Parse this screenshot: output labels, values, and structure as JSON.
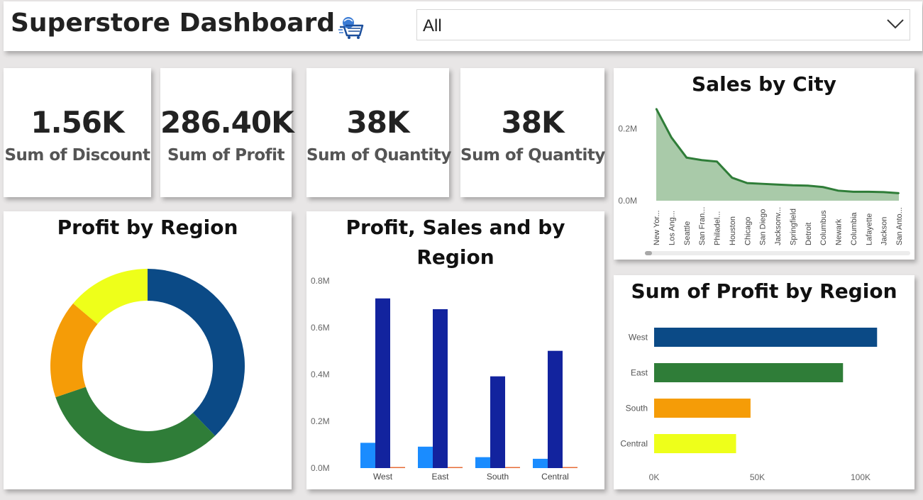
{
  "header": {
    "title": "Superstore Dashboard",
    "logo_icon": "shopping-cart-icon",
    "filter_value": "All",
    "filter_icon": "chevron-down-icon"
  },
  "kpis": [
    {
      "value": "1.56K",
      "label": "Sum of Discount"
    },
    {
      "value": "286.40K",
      "label": "Sum of Profit"
    },
    {
      "value": "38K",
      "label": "Sum of Quantity"
    },
    {
      "value": "38K",
      "label": "Sum of Quantity"
    }
  ],
  "colors": {
    "west": "#0b4a86",
    "east": "#2f7d38",
    "south": "#f59c07",
    "central": "#eeff1a",
    "profit": "#1a8cff",
    "sales": "#12239e",
    "third": "#e66c37",
    "area_line": "#2f7d38",
    "area_fill": "#a9caa9"
  },
  "chart_data": [
    {
      "id": "sales_by_city",
      "type": "area",
      "title": "Sales by City",
      "categories": [
        "New Yor...",
        "Los Ang...",
        "Seattle",
        "San Fran...",
        "Philadel...",
        "Houston",
        "Chicago",
        "San Diego",
        "Jacksonv...",
        "Springfield",
        "Detroit",
        "Columbus",
        "Newark",
        "Columbia",
        "Lafayette",
        "Jackson",
        "San Anto..."
      ],
      "values": [
        256000,
        176000,
        120000,
        113000,
        109000,
        64000,
        49000,
        47000,
        45000,
        43000,
        42000,
        38000,
        28000,
        25000,
        25000,
        24000,
        21000
      ],
      "yticks": [
        "0.0M",
        "0.2M"
      ],
      "ylim": [
        0,
        300000
      ],
      "grid": false
    },
    {
      "id": "profit_by_region_donut",
      "type": "pie",
      "title": "Profit by Region",
      "categories": [
        "West",
        "East",
        "South",
        "Central"
      ],
      "values": [
        108000,
        91500,
        46700,
        39700
      ]
    },
    {
      "id": "profit_sales_by_region",
      "type": "bar",
      "title": "Profit, Sales and by Region",
      "categories": [
        "West",
        "East",
        "South",
        "Central"
      ],
      "series": [
        {
          "values": [
            108000,
            91500,
            46700,
            39700
          ]
        },
        {
          "values": [
            725000,
            679000,
            392000,
            501000
          ]
        },
        {
          "values": [
            2000,
            2000,
            2000,
            2000
          ]
        }
      ],
      "yticks": [
        "0.0M",
        "0.2M",
        "0.4M",
        "0.6M",
        "0.8M"
      ],
      "ylim": [
        0,
        800000
      ]
    },
    {
      "id": "sum_profit_by_region",
      "type": "bar",
      "orientation": "horizontal",
      "title": "Sum of Profit by Region",
      "categories": [
        "West",
        "East",
        "South",
        "Central"
      ],
      "values": [
        108000,
        91500,
        46700,
        39700
      ],
      "xticks": [
        "0K",
        "50K",
        "100K"
      ],
      "xlim": [
        0,
        100000
      ]
    }
  ]
}
